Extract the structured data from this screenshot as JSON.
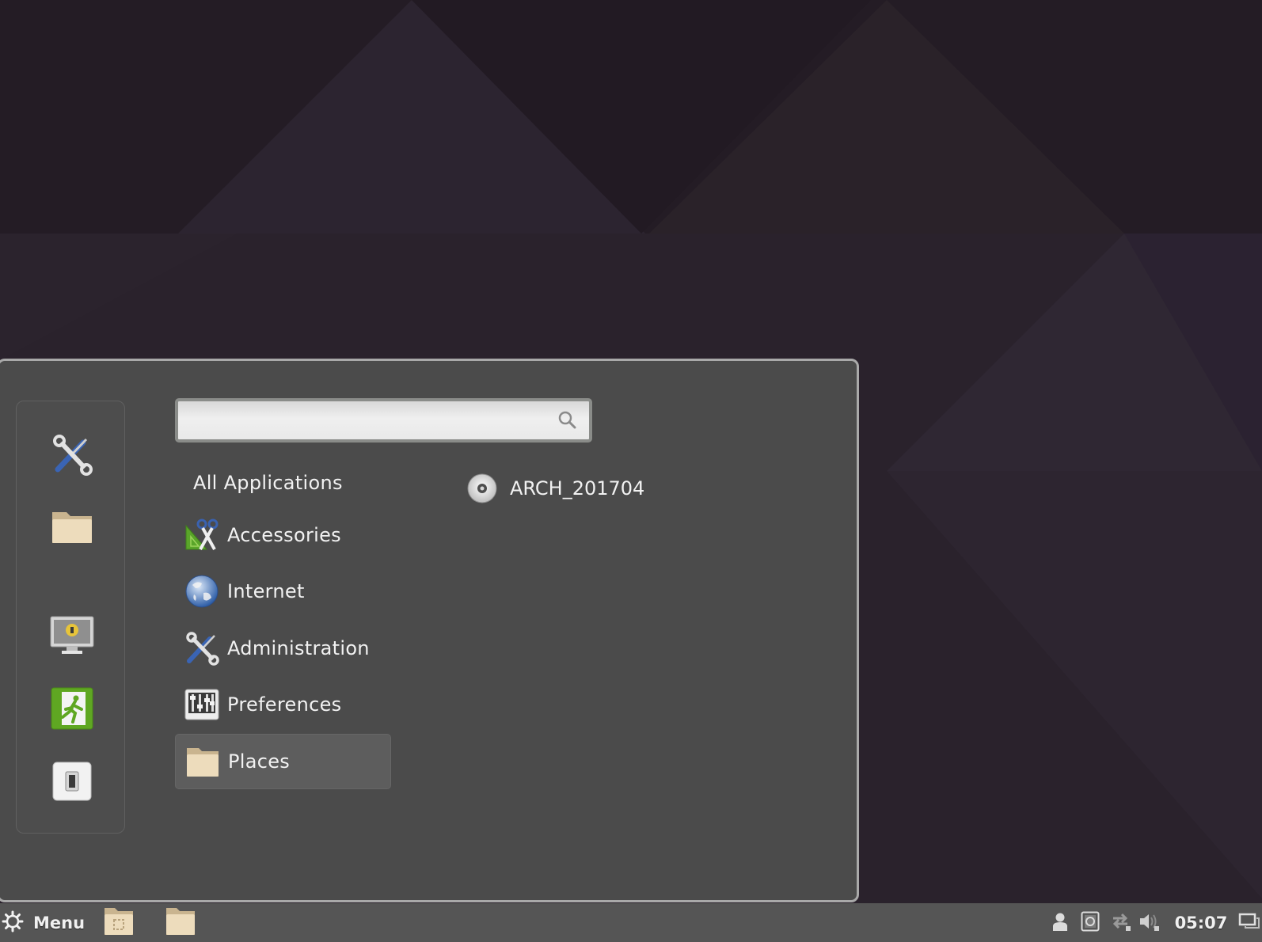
{
  "desktop": {
    "background_color": "#261e28"
  },
  "menu": {
    "favorites": [
      {
        "name": "system-tools",
        "icon": "tools-icon"
      },
      {
        "name": "files",
        "icon": "folder-icon"
      },
      {
        "name": "lock-screen",
        "icon": "lock-screen-icon"
      },
      {
        "name": "logout",
        "icon": "exit-icon"
      },
      {
        "name": "shutdown",
        "icon": "power-switch-icon"
      }
    ],
    "search": {
      "value": "",
      "placeholder": ""
    },
    "categories": [
      {
        "label": "All Applications",
        "icon": null,
        "selected": false
      },
      {
        "label": "Accessories",
        "icon": "accessories-icon",
        "selected": false
      },
      {
        "label": "Internet",
        "icon": "globe-icon",
        "selected": false
      },
      {
        "label": "Administration",
        "icon": "tools-icon",
        "selected": false
      },
      {
        "label": "Preferences",
        "icon": "preferences-icon",
        "selected": false
      },
      {
        "label": "Places",
        "icon": "folder-icon",
        "selected": true
      }
    ],
    "places": [
      {
        "label": "ARCH_201704",
        "icon": "optical-disc-icon"
      }
    ]
  },
  "taskbar": {
    "menu_label": "Menu",
    "launchers": [
      {
        "name": "home-folder",
        "icon": "folder-home-icon"
      },
      {
        "name": "folder",
        "icon": "folder-icon"
      }
    ],
    "tray": [
      "user-icon",
      "removable-drive-icon",
      "network-icon",
      "volume-muted-icon"
    ],
    "clock": "05:07",
    "show_desktop_icon": "show-desktop-icon"
  }
}
